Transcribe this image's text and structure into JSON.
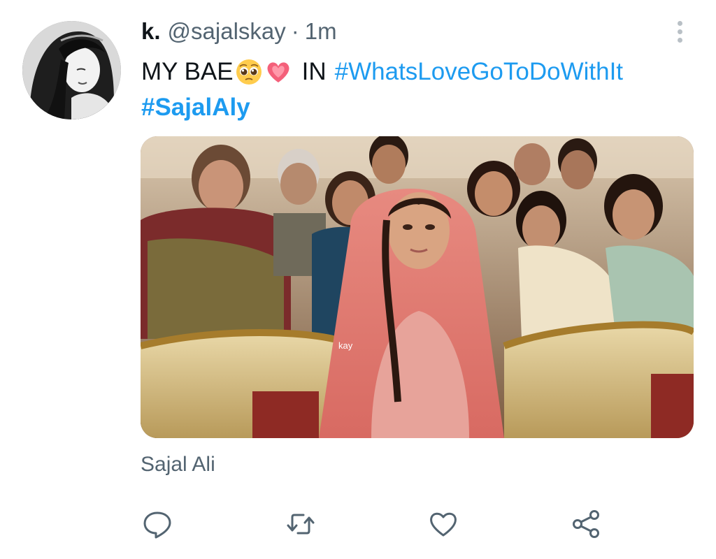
{
  "tweet": {
    "author": {
      "display_name": "k.",
      "handle": "@sajalskay",
      "separator": "·",
      "time": "1m"
    },
    "text": {
      "prefix": "MY BAE",
      "middle": "IN",
      "hashtag1": "#WhatsLoveGoToDoWithIt",
      "hashtag2": "#SajalAly",
      "emojis": [
        "pleading-face-emoji",
        "sparkling-heart-emoji"
      ]
    },
    "media": {
      "watermark": "kay"
    },
    "tagged_people": "Sajal Ali"
  },
  "icons": {
    "more": "more-vertical-icon",
    "reply": "reply-icon",
    "retweet": "retweet-icon",
    "like": "heart-icon",
    "share": "share-icon"
  },
  "colors": {
    "link": "#1d9bf0",
    "text": "#0f1419",
    "secondary": "#536471",
    "icon": "#536471"
  }
}
